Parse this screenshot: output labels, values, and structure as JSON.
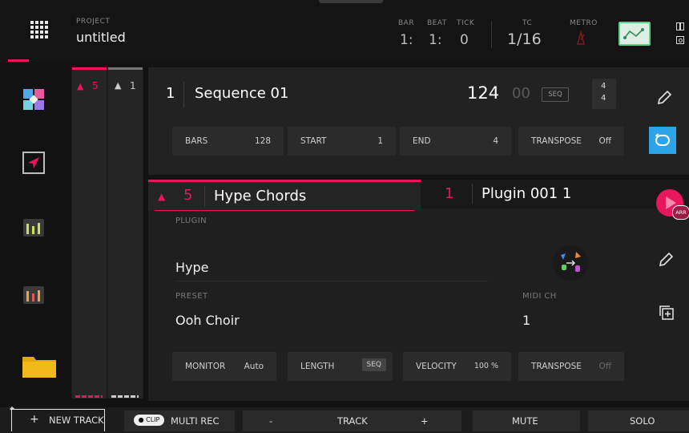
{
  "header": {
    "project_label": "PROJECT",
    "project_name": "untitled",
    "bar_label": "BAR",
    "beat_label": "BEAT",
    "tick_label": "TICK",
    "bar_value": "1:",
    "beat_value": "1:",
    "tick_value": "0",
    "tc_label": "TC",
    "tc_value": "1/16",
    "metro_label": "METRO"
  },
  "track_columns": {
    "col1": "5",
    "col2": "1"
  },
  "sequence": {
    "number": "1",
    "name": "Sequence 01",
    "bpm": "124",
    "bpm_decimal": "00",
    "seq_badge": "SEQ",
    "timesig_top": "4",
    "timesig_bottom": "4",
    "fields": [
      {
        "label": "BARS",
        "value": "128"
      },
      {
        "label": "START",
        "value": "1"
      },
      {
        "label": "END",
        "value": "4"
      },
      {
        "label": "TRANSPOSE",
        "value": "Off"
      }
    ]
  },
  "track": {
    "tab_number": "5",
    "tab_name": "Hype Chords",
    "plugin_tab_number": "1",
    "plugin_tab_name": "Plugin 001 1",
    "arr_badge": "ARR",
    "plugin_label": "PLUGIN",
    "plugin_value": "Hype",
    "preset_label": "PRESET",
    "preset_value": "Ooh Choir",
    "midi_ch_label": "MIDI CH",
    "midi_ch_value": "1",
    "fields": [
      {
        "label": "MONITOR",
        "value": "Auto"
      },
      {
        "label": "LENGTH",
        "value": "SEQ"
      },
      {
        "label": "VELOCITY",
        "value": "100 %"
      },
      {
        "label": "TRANSPOSE",
        "value": "Off"
      }
    ]
  },
  "bottom_bar": {
    "new_track": "NEW TRACK",
    "new_track_plus": "+",
    "clip_badge": "CLIP",
    "multi_rec": "MULTI REC",
    "minus": "-",
    "track": "TRACK",
    "plus": "+",
    "mute": "MUTE",
    "solo": "SOLO"
  },
  "colors": {
    "accent_pink": "#e8175d",
    "accent_blue": "#2ea4e8",
    "metro_green": "#5ecf8a"
  }
}
